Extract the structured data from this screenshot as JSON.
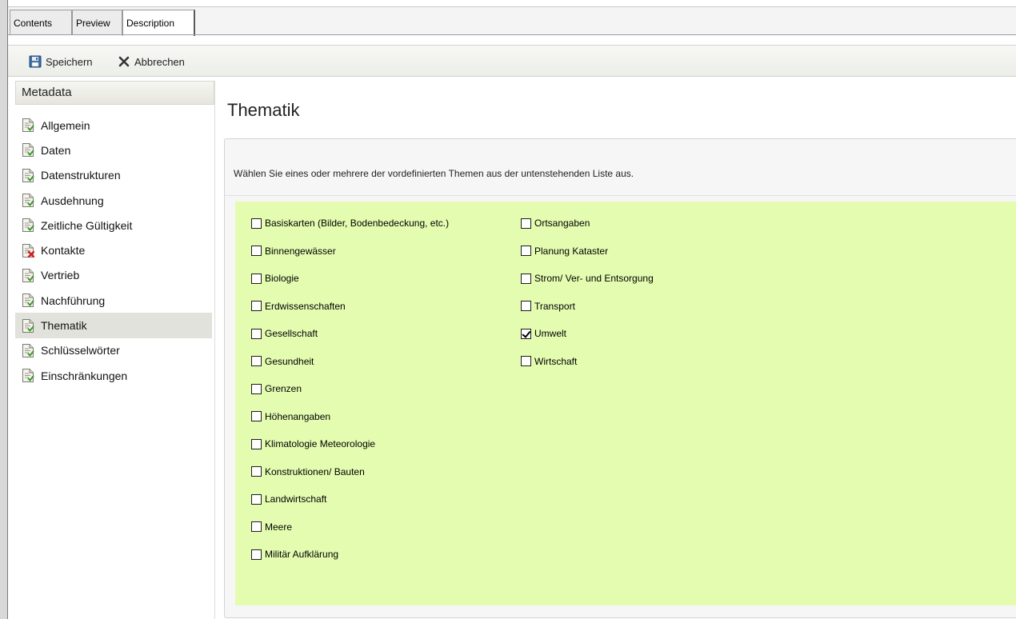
{
  "tabs": [
    {
      "label": "Contents",
      "active": false
    },
    {
      "label": "Preview",
      "active": false
    },
    {
      "label": "Description",
      "active": true
    }
  ],
  "toolbar": {
    "save_label": "Speichern",
    "cancel_label": "Abbrechen"
  },
  "sidebar": {
    "header": "Metadata",
    "items": [
      {
        "label": "Allgemein",
        "icon": "document-check-icon"
      },
      {
        "label": "Daten",
        "icon": "document-check-icon"
      },
      {
        "label": "Datenstrukturen",
        "icon": "document-check-icon"
      },
      {
        "label": "Ausdehnung",
        "icon": "document-check-icon"
      },
      {
        "label": "Zeitliche Gültigkeit",
        "icon": "document-check-icon"
      },
      {
        "label": "Kontakte",
        "icon": "document-error-icon"
      },
      {
        "label": "Vertrieb",
        "icon": "document-check-icon"
      },
      {
        "label": "Nachführung",
        "icon": "document-check-icon"
      },
      {
        "label": "Thematik",
        "icon": "document-check-icon",
        "selected": true
      },
      {
        "label": "Schlüsselwörter",
        "icon": "document-check-icon"
      },
      {
        "label": "Einschränkungen",
        "icon": "document-check-icon"
      }
    ]
  },
  "main": {
    "title": "Thematik",
    "description": "Wählen Sie eines oder mehrere der vordefinierten Themen aus der untenstehenden Liste aus.",
    "left_topics": [
      {
        "label": "Basiskarten (Bilder, Bodenbedeckung, etc.)",
        "checked": false
      },
      {
        "label": "Binnengewässer",
        "checked": false
      },
      {
        "label": "Biologie",
        "checked": false
      },
      {
        "label": "Erdwissenschaften",
        "checked": false
      },
      {
        "label": "Gesellschaft",
        "checked": false
      },
      {
        "label": "Gesundheit",
        "checked": false
      },
      {
        "label": "Grenzen",
        "checked": false
      },
      {
        "label": "Höhenangaben",
        "checked": false
      },
      {
        "label": "Klimatologie Meteorologie",
        "checked": false
      },
      {
        "label": "Konstruktionen/ Bauten",
        "checked": false
      },
      {
        "label": "Landwirtschaft",
        "checked": false
      },
      {
        "label": "Meere",
        "checked": false
      },
      {
        "label": "Militär Aufklärung",
        "checked": false
      }
    ],
    "right_topics": [
      {
        "label": "Ortsangaben",
        "checked": false
      },
      {
        "label": "Planung Kataster",
        "checked": false
      },
      {
        "label": "Strom/ Ver- und Entsorgung",
        "checked": false
      },
      {
        "label": "Transport",
        "checked": false
      },
      {
        "label": "Umwelt",
        "checked": true
      },
      {
        "label": "Wirtschaft",
        "checked": false
      }
    ]
  },
  "colors": {
    "topic_panel_bg": "#e4fcb0",
    "selected_nav_bg": "#e2e2dc",
    "error_icon": "#d42020"
  }
}
